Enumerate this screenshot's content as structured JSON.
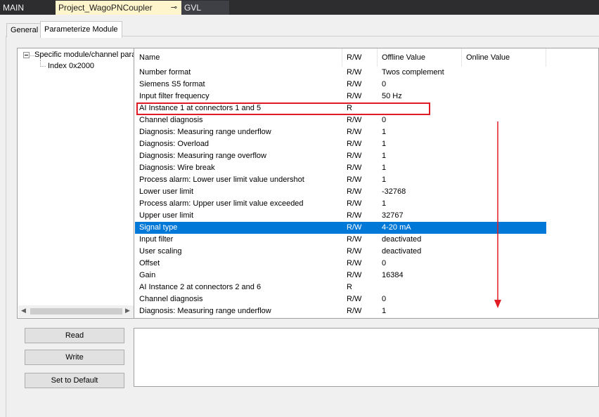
{
  "document_tabs": [
    {
      "label": "MAIN"
    },
    {
      "label": "Project_WagoPNCoupler",
      "pin": "⊸"
    },
    {
      "label": "GVL"
    }
  ],
  "editor_tabs": [
    {
      "label": "General"
    },
    {
      "label": "Parameterize Module"
    }
  ],
  "tree": {
    "root_label": "Specific module/channel para",
    "child_label": "Index 0x2000",
    "scroll_left_icon": "◀",
    "scroll_right_icon": "▶"
  },
  "grid": {
    "columns": {
      "name": "Name",
      "rw": "R/W",
      "offline": "Offline Value",
      "online": "Online Value"
    },
    "selected_row": 13,
    "rows": [
      {
        "name": "Number format",
        "rw": "R/W",
        "offline": "Twos complement",
        "online": ""
      },
      {
        "name": "Siemens S5 format",
        "rw": "R/W",
        "offline": "0",
        "online": ""
      },
      {
        "name": "Input filter frequency",
        "rw": "R/W",
        "offline": "50 Hz",
        "online": ""
      },
      {
        "name": "AI Instance 1 at connectors 1 and 5",
        "rw": "R",
        "offline": "",
        "online": ""
      },
      {
        "name": "Channel diagnosis",
        "rw": "R/W",
        "offline": "0",
        "online": ""
      },
      {
        "name": "Diagnosis: Measuring range underflow",
        "rw": "R/W",
        "offline": "1",
        "online": ""
      },
      {
        "name": "Diagnosis: Overload",
        "rw": "R/W",
        "offline": "1",
        "online": ""
      },
      {
        "name": "Diagnosis: Measuring range overflow",
        "rw": "R/W",
        "offline": "1",
        "online": ""
      },
      {
        "name": "Diagnosis: Wire break",
        "rw": "R/W",
        "offline": "1",
        "online": ""
      },
      {
        "name": "Process alarm: Lower user limit value undershot",
        "rw": "R/W",
        "offline": "1",
        "online": ""
      },
      {
        "name": "Lower user limit",
        "rw": "R/W",
        "offline": "-32768",
        "online": ""
      },
      {
        "name": "Process alarm: Upper user limit value exceeded",
        "rw": "R/W",
        "offline": "1",
        "online": ""
      },
      {
        "name": "Upper user limit",
        "rw": "R/W",
        "offline": "32767",
        "online": ""
      },
      {
        "name": "Signal type",
        "rw": "R/W",
        "offline": "4-20 mA",
        "online": ""
      },
      {
        "name": "Input filter",
        "rw": "R/W",
        "offline": "deactivated",
        "online": ""
      },
      {
        "name": "User scaling",
        "rw": "R/W",
        "offline": "deactivated",
        "online": ""
      },
      {
        "name": "Offset",
        "rw": "R/W",
        "offline": "0",
        "online": ""
      },
      {
        "name": "Gain",
        "rw": "R/W",
        "offline": "16384",
        "online": ""
      },
      {
        "name": "AI Instance 2 at connectors 2 and 6",
        "rw": "R",
        "offline": "",
        "online": ""
      },
      {
        "name": "Channel diagnosis",
        "rw": "R/W",
        "offline": "0",
        "online": ""
      },
      {
        "name": "Diagnosis: Measuring range underflow",
        "rw": "R/W",
        "offline": "1",
        "online": ""
      }
    ]
  },
  "buttons": {
    "read": "Read",
    "write": "Write",
    "default": "Set to Default"
  },
  "annotation": {
    "box_color": "#e01b24",
    "arrow_color": "#e01b24"
  },
  "colors": {
    "selection": "#0078d7",
    "tab_strip": "#2d2d30",
    "active_doc_tab": "#fff5cc"
  }
}
